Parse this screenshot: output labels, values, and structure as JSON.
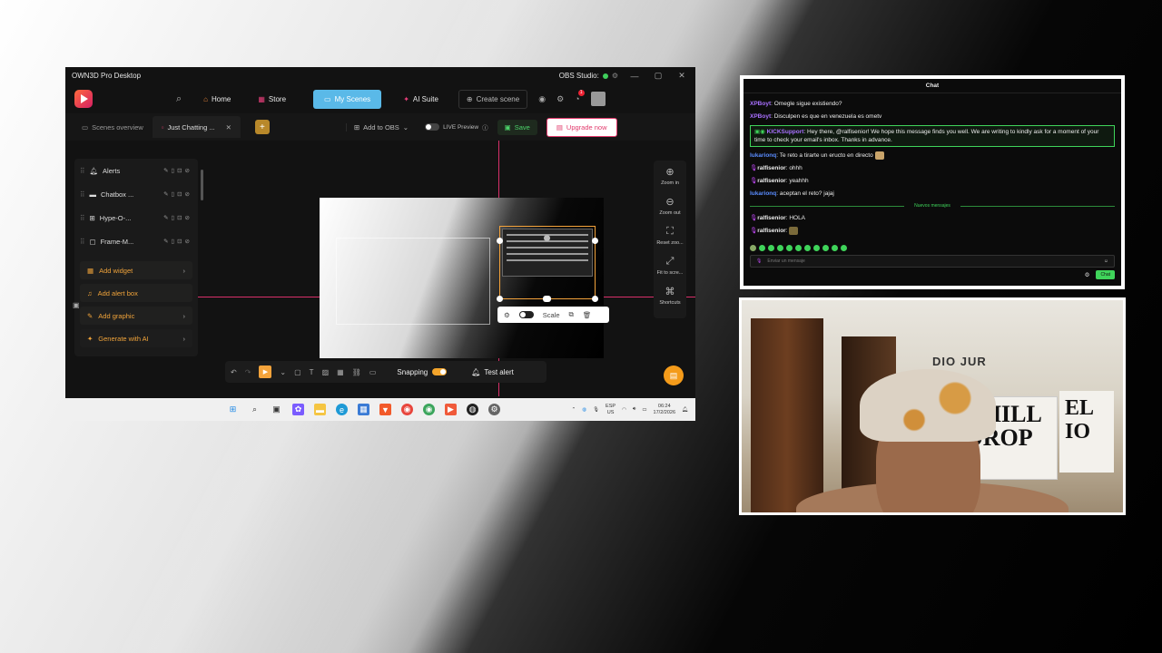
{
  "own3d": {
    "window_title": "OWN3D Pro Desktop",
    "obs_status": "OBS Studio:",
    "nav": {
      "home": "Home",
      "store": "Store",
      "my_scenes": "My Scenes",
      "ai_suite": "AI Suite",
      "create_scene": "Create scene",
      "notif_count": "1"
    },
    "tabs": {
      "overview": "Scenes overview",
      "active": "Just Chatting ...",
      "add_to_obs": "Add to OBS",
      "live_preview": "LIVE Preview",
      "save": "Save",
      "upgrade": "Upgrade now"
    },
    "layers": [
      {
        "name": "Alerts"
      },
      {
        "name": "Chatbox ..."
      },
      {
        "name": "Hype-O-..."
      },
      {
        "name": "Frame-M..."
      }
    ],
    "actions": {
      "add_widget": "Add widget",
      "add_alert_box": "Add alert box",
      "add_graphic": "Add graphic",
      "generate_ai": "Generate with AI"
    },
    "zoom": {
      "zoom_in": "Zoom in",
      "zoom_out": "Zoom out",
      "reset_zoom": "Reset zoo...",
      "fit": "Fit to scre...",
      "shortcuts": "Shortcuts"
    },
    "scale_label": "Scale",
    "toolbar": {
      "snapping": "Snapping",
      "test_alert": "Test alert"
    },
    "taskbar": {
      "lang_1": "ESP",
      "lang_2": "US",
      "time": "06:24",
      "date": "17/2/2026"
    }
  },
  "chat": {
    "header": "Chat",
    "messages": [
      {
        "user": "XPBoyt",
        "text": ": Omegle sigue existiendo?",
        "color": "#a970ff"
      },
      {
        "user": "XPBoyt",
        "text": ": Disculpen es que en venezuela es ometv",
        "color": "#a970ff"
      },
      {
        "user": "KICKSupport",
        "text": ": Hey there, @ralfisenior! We hope this message finds you well. We are writing to kindly ask for a moment of your time to check your email's inbox. Thanks in advance.",
        "color": "#a970ff"
      },
      {
        "user": "lukarionq",
        "text": ": Te reto a tirarte un eructo en directo",
        "color": "#5a8cff"
      },
      {
        "user": "ralfisenior",
        "text": ": ohhh",
        "color": "#ffffff"
      },
      {
        "user": "ralfisenior",
        "text": ": yeahhh",
        "color": "#ffffff"
      },
      {
        "user": "lukarionq",
        "text": ": aceptan el reto? jajaj",
        "color": "#5a8cff"
      }
    ],
    "new_messages": "Nuevos mensajes",
    "messages_after": [
      {
        "user": "ralfisenior",
        "text": ": HOLA",
        "color": "#ffffff"
      },
      {
        "user": "ralfisenior",
        "text": ":",
        "color": "#ffffff"
      }
    ],
    "input_placeholder": "Enviar un mensaje",
    "send_label": "Chat"
  },
  "webcam": {
    "sign_text": "DIO JUR",
    "poster_text": "CHILL DROP",
    "poster2_text": "EL IO"
  },
  "colors": {
    "accent_orange": "#f4a33b",
    "scenes_blue": "#5ab9e8",
    "guideline_pink": "#d8306a",
    "kick_green": "#3fd45a"
  }
}
